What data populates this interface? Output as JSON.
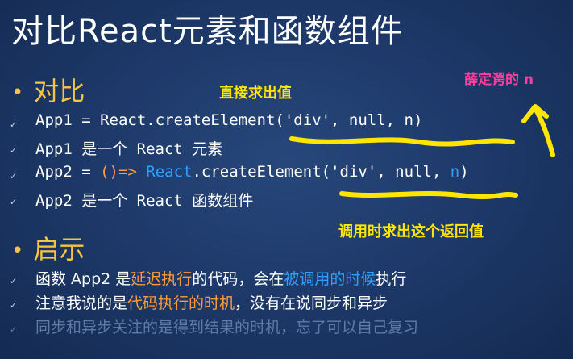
{
  "title": "对比React元素和函数组件",
  "section1": {
    "heading": "对比",
    "lines": [
      {
        "text": "App1 = React.createElement('div', null, n)"
      },
      {
        "text": "App1 是一个 React 元素"
      },
      {
        "a": "App2 = ",
        "b": "()=> ",
        "c": "React",
        "d": ".createElement('div', null, ",
        "e": "n",
        "f": ")"
      },
      {
        "text": "App2 是一个 React 函数组件"
      }
    ]
  },
  "section2": {
    "heading": "启示",
    "lines": [
      {
        "a": "函数 App2 是",
        "b": "延迟执行",
        "c": "的代码，会在",
        "d": "被调用的时候",
        "e": "执行"
      },
      {
        "a": "注意我说的是",
        "b": "代码执行的时机",
        "c": "，没有在说同步和异步"
      },
      {
        "text": "同步和异步关注的是得到结果的时机，忘了可以自己复习"
      }
    ]
  },
  "annotations": {
    "direct_value": "直接求出值",
    "call_time_value": "调用时求出这个返回值",
    "pink_note": "薛定谔的 n"
  },
  "colors": {
    "heading": "#f5c542",
    "highlight_orange": "#ff9b3d",
    "highlight_blue": "#2fa0ff",
    "annotation_yellow": "#ffe500",
    "annotation_pink": "#ff3fa0"
  }
}
